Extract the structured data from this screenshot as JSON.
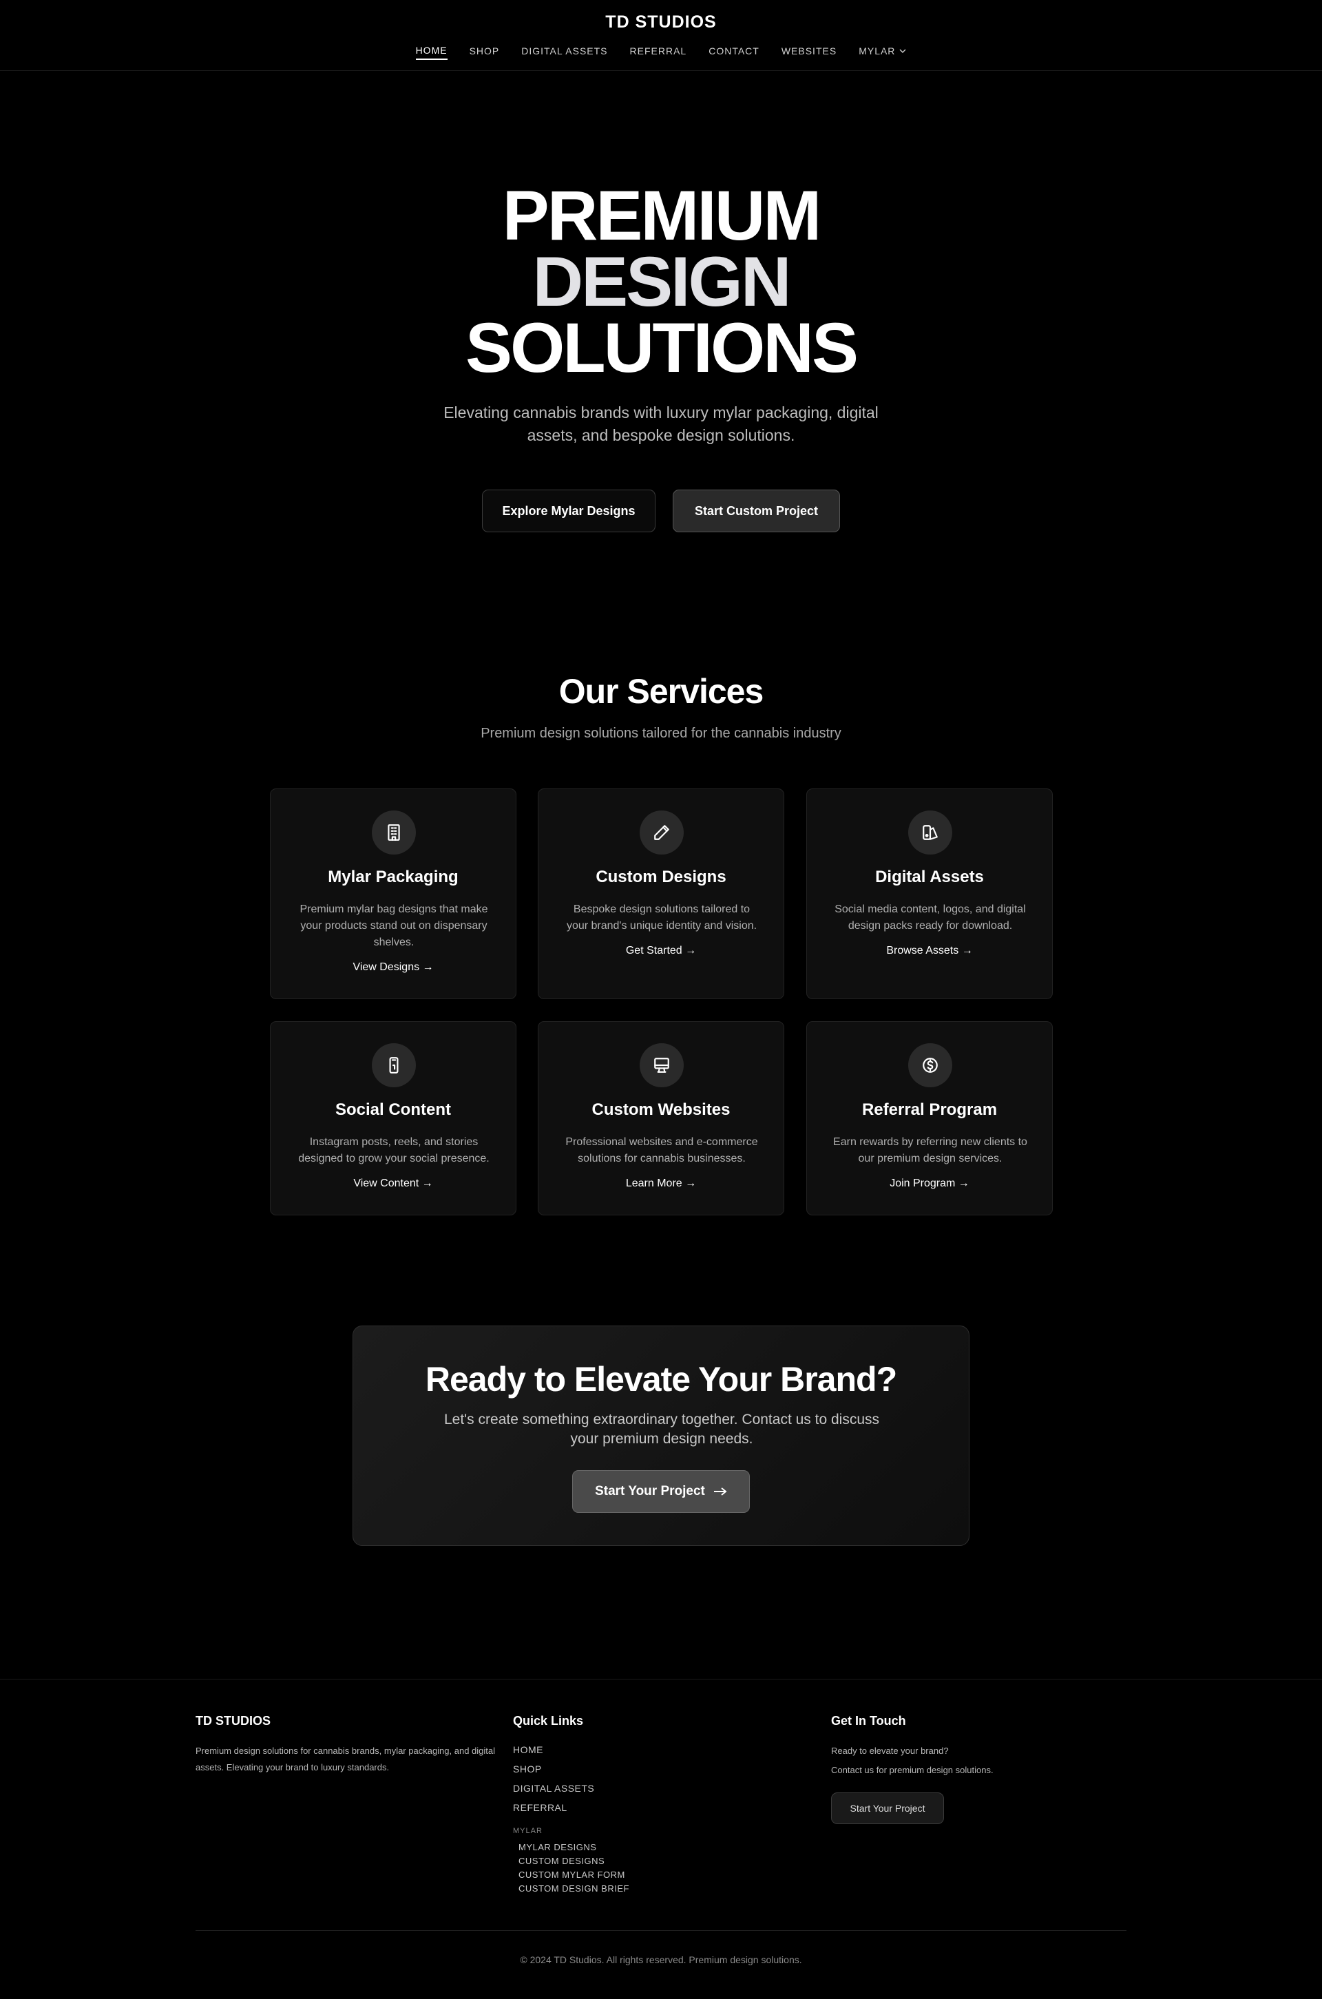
{
  "header": {
    "brand": "TD STUDIOS",
    "nav": [
      {
        "label": "HOME",
        "active": true
      },
      {
        "label": "SHOP"
      },
      {
        "label": "DIGITAL ASSETS"
      },
      {
        "label": "REFERRAL"
      },
      {
        "label": "CONTACT"
      },
      {
        "label": "WEBSITES"
      },
      {
        "label": "MYLAR",
        "dropdown": true
      }
    ]
  },
  "hero": {
    "title_lines": [
      "PREMIUM",
      "DESIGN",
      "SOLUTIONS"
    ],
    "subtitle": "Elevating cannabis brands with luxury mylar packaging, digital assets, and bespoke design solutions.",
    "btn_primary": "Explore Mylar Designs",
    "btn_secondary": "Start Custom Project"
  },
  "services": {
    "title": "Our Services",
    "subtitle": "Premium design solutions tailored for the cannabis industry",
    "cards": [
      {
        "icon": "building-icon",
        "title": "Mylar Packaging",
        "desc": "Premium mylar bag designs that make your products stand out on dispensary shelves.",
        "link": "View Designs →"
      },
      {
        "icon": "pencil-icon",
        "title": "Custom Designs",
        "desc": "Bespoke design solutions tailored to your brand's unique identity and vision.",
        "link": "Get Started →"
      },
      {
        "icon": "palette-icon",
        "title": "Digital Assets",
        "desc": "Social media content, logos, and digital design packs ready for download.",
        "link": "Browse Assets →"
      },
      {
        "icon": "phone-icon",
        "title": "Social Content",
        "desc": "Instagram posts, reels, and stories designed to grow your social presence.",
        "link": "View Content →"
      },
      {
        "icon": "monitor-icon",
        "title": "Custom Websites",
        "desc": "Professional websites and e-commerce solutions for cannabis businesses.",
        "link": "Learn More →"
      },
      {
        "icon": "dollar-circle-icon",
        "title": "Referral Program",
        "desc": "Earn rewards by referring new clients to our premium design services.",
        "link": "Join Program →"
      }
    ]
  },
  "cta": {
    "title": "Ready to Elevate Your Brand?",
    "subtitle": "Let's create something extraordinary together. Contact us to discuss your premium design needs.",
    "button": "Start Your Project"
  },
  "footer": {
    "brand": "TD STUDIOS",
    "about": "Premium design solutions for cannabis brands, mylar packaging, and digital assets. Elevating your brand to luxury standards.",
    "quick_links_title": "Quick Links",
    "quick_links": [
      "HOME",
      "SHOP",
      "DIGITAL ASSETS",
      "REFERRAL"
    ],
    "mylar_label": "MYLAR",
    "mylar_links": [
      "MYLAR DESIGNS",
      "CUSTOM DESIGNS",
      "CUSTOM MYLAR FORM",
      "CUSTOM DESIGN BRIEF"
    ],
    "contact_title": "Get In Touch",
    "contact_line1": "Ready to elevate your brand?",
    "contact_line2": "Contact us for premium design solutions.",
    "contact_button": "Start Your Project",
    "copyright": "© 2024 TD Studios. All rights reserved. Premium design solutions."
  }
}
